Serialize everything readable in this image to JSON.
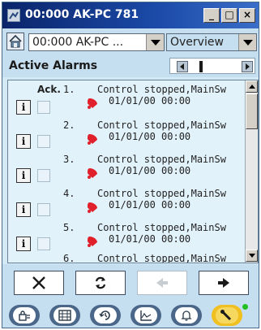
{
  "window": {
    "title": "00:000 AK-PC 781"
  },
  "titlebar_buttons": {
    "minimize": "_",
    "maximize": "□",
    "close": "×"
  },
  "toolbar": {
    "device_select": {
      "value": "00:000 AK-PC ..."
    },
    "view_select": {
      "value": "Overview"
    }
  },
  "header": {
    "title": "Active Alarms"
  },
  "list": {
    "ack_header": "Ack.",
    "rows": [
      {
        "number": "1.",
        "message": "Control stopped,MainSw",
        "date": "01/01/00 00:00",
        "info_label": "i"
      },
      {
        "number": "2.",
        "message": "Control stopped,MainSw",
        "date": "01/01/00 00:00",
        "info_label": "i"
      },
      {
        "number": "3.",
        "message": "Control stopped,MainSw",
        "date": "01/01/00 00:00",
        "info_label": "i"
      },
      {
        "number": "4.",
        "message": "Control stopped,MainSw",
        "date": "01/01/00 00:00",
        "info_label": "i"
      },
      {
        "number": "5.",
        "message": "Control stopped,MainSw",
        "date": "01/01/00 00:00",
        "info_label": "i"
      },
      {
        "number": "6.",
        "message": "Control stopped,MainSw",
        "date": "",
        "info_label": ""
      }
    ]
  },
  "actions": [
    {
      "icon": "x-icon"
    },
    {
      "icon": "refresh-icon"
    },
    {
      "icon": "arrow-left-icon",
      "disabled": true
    },
    {
      "icon": "arrow-right-icon"
    }
  ],
  "bottom_nav": [
    {
      "icon": "lock-icon"
    },
    {
      "icon": "grid-icon"
    },
    {
      "icon": "history-icon"
    },
    {
      "icon": "graph-icon"
    },
    {
      "icon": "bell-icon"
    },
    {
      "icon": "wrench-icon",
      "active": true
    }
  ],
  "colors": {
    "title_bar": "#0a246a",
    "panel": "#c6dff0",
    "list_bg": "#e2f2fb",
    "alarm": "#e0202a",
    "active_tab": "#f0c020",
    "nav_tab": "#4a6688",
    "status_ok": "#22c022"
  }
}
